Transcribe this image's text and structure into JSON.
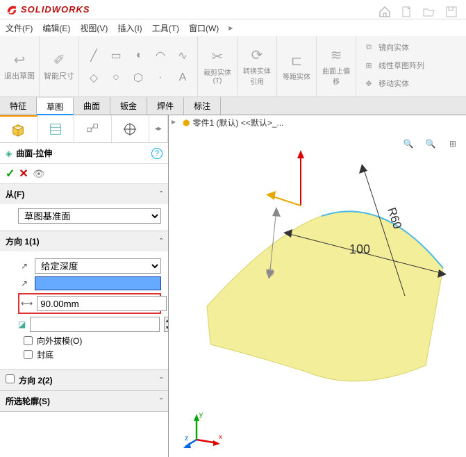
{
  "app": {
    "name": "SOLIDWORKS"
  },
  "menu": {
    "file": "文件(F)",
    "edit": "编辑(E)",
    "view": "视图(V)",
    "insert": "插入(I)",
    "tools": "工具(T)",
    "window": "窗口(W)"
  },
  "toolbar": {
    "exit_sketch": "退出草图",
    "smart_dim": "智能尺寸",
    "trim": "裁剪实体(T)",
    "convert": "转换实体引用",
    "offset_surface": "等距实体",
    "surface_offset": "曲面上偏移",
    "mirror": "镜向实体",
    "linear_pattern": "线性草图阵列",
    "move": "移动实体"
  },
  "tabs": {
    "feature": "特征",
    "sketch": "草图",
    "surface": "曲面",
    "sheet_metal": "钣金",
    "weldment": "焊件",
    "annotate": "标注"
  },
  "feature": {
    "title": "曲面-拉伸",
    "from": {
      "label": "从(F)",
      "value": "草图基准面"
    },
    "dir1": {
      "label": "方向 1(1)",
      "end_condition": "给定深度",
      "depth": "90.00mm",
      "draft_outward": "向外拔模(O)",
      "cap": "封底"
    },
    "dir2": {
      "label": "方向 2(2)"
    },
    "contours": {
      "label": "所选轮廓(S)"
    }
  },
  "crumb": {
    "text": "零件1 (默认) <<默认>_..."
  },
  "dims": {
    "d1": "100",
    "r": "R60"
  },
  "triad": {
    "x": "x",
    "y": "y",
    "z": "z"
  }
}
